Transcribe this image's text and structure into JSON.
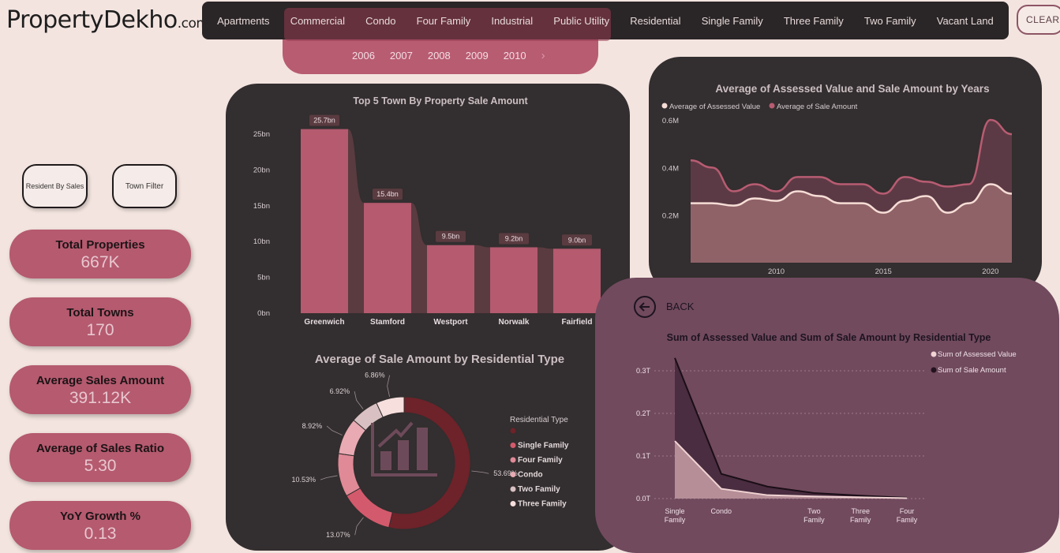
{
  "brand": {
    "name": "PropertyDekho",
    "domain": ".com"
  },
  "nav": {
    "items": [
      "Apartments",
      "Commercial",
      "Condo",
      "Four Family",
      "Industrial",
      "Public Utility",
      "Residential",
      "Single Family",
      "Three Family",
      "Two Family",
      "Vacant Land"
    ],
    "clear_label": "CLEAR"
  },
  "years": {
    "items": [
      "2006",
      "2007",
      "2008",
      "2009",
      "2010"
    ],
    "next_icon": "chevron-right-icon"
  },
  "buttons": {
    "resident_by_sales": "Resident By Sales",
    "town_filter": "Town Filter"
  },
  "kpis": [
    {
      "title": "Total Properties",
      "value": "667K"
    },
    {
      "title": "Total Towns",
      "value": "170"
    },
    {
      "title": "Average Sales Amount",
      "value": "391.12K"
    },
    {
      "title": "Average of Sales Ratio",
      "value": "5.30"
    },
    {
      "title": "YoY Growth %",
      "value": "0.13"
    }
  ],
  "back": {
    "label": "BACK"
  },
  "colors": {
    "accent": "#b55a6f",
    "panel": "#332e2f",
    "bg": "#f3e4df",
    "drill_panel": "#714a5e"
  },
  "chart_data": [
    {
      "type": "bar",
      "title": "Top 5 Town By Property Sale Amount",
      "categories": [
        "Greenwich",
        "Stamford",
        "Westport",
        "Norwalk",
        "Fairfield"
      ],
      "values": [
        25.7,
        15.4,
        9.5,
        9.2,
        9.0
      ],
      "data_labels": [
        "25.7bn",
        "15.4bn",
        "9.5bn",
        "9.2bn",
        "9.0bn"
      ],
      "yticks": [
        "0bn",
        "5bn",
        "10bn",
        "15bn",
        "20bn",
        "25bn"
      ],
      "ylim": [
        0,
        25
      ]
    },
    {
      "type": "pie",
      "title": "Average of Sale Amount by Residential Type",
      "legend_title": "Residential Type",
      "legend": [
        "",
        "Single Family",
        "Four Family",
        "Condo",
        "Two Family",
        "Three Family"
      ],
      "slices": [
        {
          "value": 53.69,
          "label": "53.69%",
          "color": "#6e2229"
        },
        {
          "value": 13.07,
          "label": "13.07%",
          "color": "#d35a6c"
        },
        {
          "value": 10.53,
          "label": "10.53%",
          "color": "#e08a97"
        },
        {
          "value": 8.92,
          "label": "8.92%",
          "color": "#e9aab3"
        },
        {
          "value": 6.92,
          "label": "6.92%",
          "color": "#d9c1c3"
        },
        {
          "value": 6.86,
          "label": "6.86%",
          "color": "#f6dfdd"
        }
      ],
      "legend_colors": [
        "#6e2229",
        "#d35a6c",
        "#e08a97",
        "#e9aab3",
        "#d9c1c3",
        "#f6dfdd"
      ]
    },
    {
      "type": "area",
      "title": "Average of Assessed Value and Sale Amount by Years",
      "x": [
        2006,
        2007,
        2008,
        2009,
        2010,
        2011,
        2012,
        2013,
        2014,
        2015,
        2016,
        2017,
        2018,
        2019,
        2020,
        2021
      ],
      "xticks": [
        "2010",
        "2015",
        "2020"
      ],
      "ylim": [
        0,
        0.6
      ],
      "yticks": [
        "0.2M",
        "0.4M",
        "0.6M"
      ],
      "series": [
        {
          "name": "Average of Sale Amount",
          "color": "#b85c72",
          "values": [
            0.43,
            0.4,
            0.3,
            0.33,
            0.3,
            0.36,
            0.36,
            0.33,
            0.33,
            0.29,
            0.36,
            0.34,
            0.32,
            0.33,
            0.6,
            0.54
          ]
        },
        {
          "name": "Average of Assessed Value",
          "color": "#f6ddd6",
          "values": [
            0.25,
            0.25,
            0.24,
            0.27,
            0.26,
            0.3,
            0.28,
            0.25,
            0.25,
            0.21,
            0.26,
            0.28,
            0.21,
            0.25,
            0.33,
            0.29
          ]
        }
      ]
    },
    {
      "type": "area",
      "title": "Sum of Assessed Value and Sum of Sale Amount by Residential Type",
      "categories": [
        "Single Family",
        "Condo",
        "",
        "Two Family",
        "Three Family",
        "Four Family"
      ],
      "yticks": [
        "0.0T",
        "0.1T",
        "0.2T",
        "0.3T"
      ],
      "ylim": [
        0,
        0.3
      ],
      "series": [
        {
          "name": "Sum of Assessed Value",
          "color": "#f0d3d3",
          "values": [
            0.135,
            0.023,
            0.008,
            0.005,
            0.003,
            0.001
          ]
        },
        {
          "name": "Sum of Sale Amount",
          "color": "#231320",
          "values": [
            0.33,
            0.058,
            0.028,
            0.013,
            0.007,
            0.002
          ]
        }
      ]
    }
  ]
}
